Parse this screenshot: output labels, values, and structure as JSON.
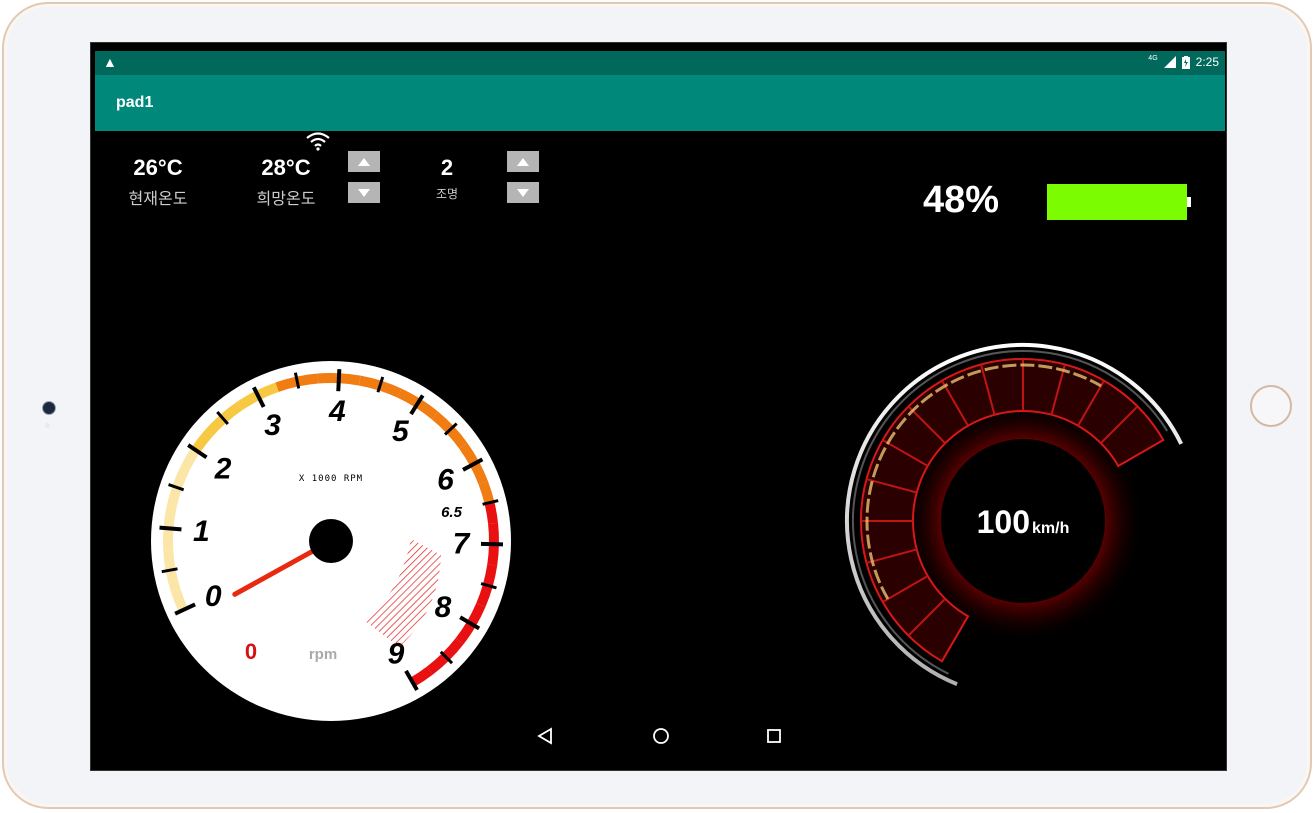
{
  "status_bar": {
    "warning_icon": "warning-icon",
    "time": "2:25",
    "network": "4G"
  },
  "app_bar": {
    "title": "pad1"
  },
  "climate": {
    "current_temp": "26°C",
    "current_label": "현재온도",
    "target_temp": "28°C",
    "target_label": "희망온도"
  },
  "lighting": {
    "value": "2",
    "label": "조명"
  },
  "battery": {
    "percent_text": "48%",
    "level": 0.48,
    "color": "#7cfc00"
  },
  "tachometer": {
    "scale_label": "X 1000 RPM",
    "ticks": [
      "0",
      "1",
      "2",
      "3",
      "4",
      "5",
      "6",
      "6.5",
      "7",
      "8",
      "9"
    ],
    "rpm_value": "0",
    "rpm_unit": "rpm"
  },
  "speedometer": {
    "value": "100",
    "unit": "km/h"
  }
}
